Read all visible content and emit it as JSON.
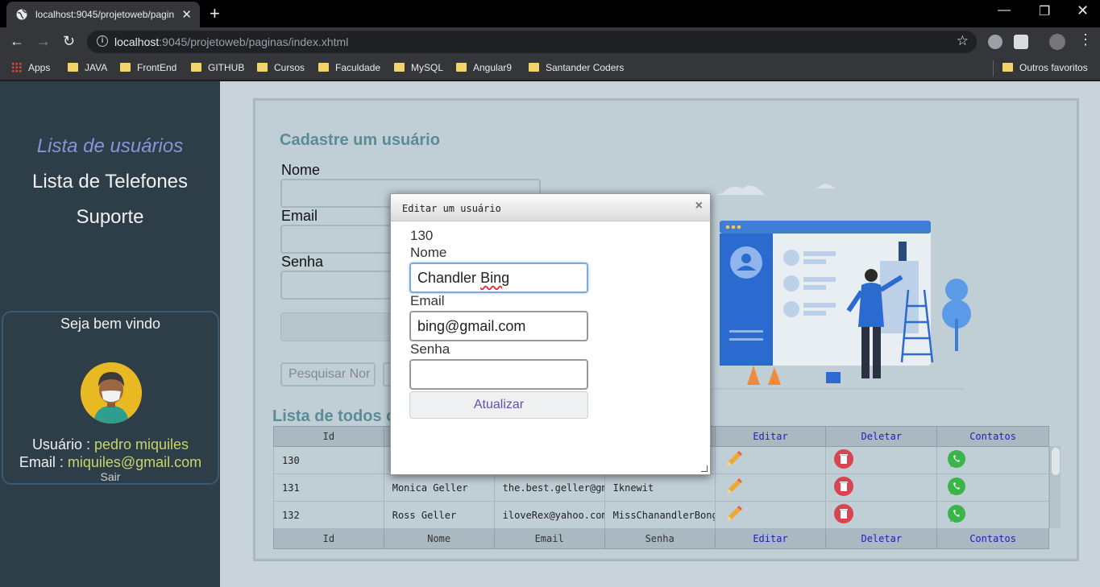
{
  "browser": {
    "tab_title": "localhost:9045/projetoweb/pagin",
    "url_host": "localhost",
    "url_rest": ":9045/projetoweb/paginas/index.xhtml",
    "bookmarks": [
      "Apps",
      "JAVA",
      "FrontEnd",
      "GITHUB",
      "Cursos",
      "Faculdade",
      "MySQL",
      "Angular9",
      "Santander Coders"
    ],
    "other_bookmarks": "Outros favoritos"
  },
  "sidebar": {
    "links": [
      "Lista de usuários",
      "Lista de Telefones",
      "Suporte"
    ],
    "welcome": "Seja bem vindo",
    "user_label": "Usuário :",
    "user_value": "pedro miquiles",
    "email_label": "Email :",
    "email_value": "miquiles@gmail.com",
    "logout": "Sair"
  },
  "form": {
    "title": "Cadastre um usuário",
    "name_label": "Nome",
    "email_label": "Email",
    "password_label": "Senha",
    "search_placeholder": "Pesquisar Nor"
  },
  "list": {
    "title": "Lista de todos o",
    "columns": [
      "Id",
      "Nome",
      "Email",
      "Senha",
      "Editar",
      "Deletar",
      "Contatos"
    ],
    "rows": [
      {
        "id": "130",
        "nome": "",
        "email": "",
        "senha": ""
      },
      {
        "id": "131",
        "nome": "Monica Geller",
        "email": "the.best.geller@gm",
        "senha": "Iknewit"
      },
      {
        "id": "132",
        "nome": "Ross Geller",
        "email": "iloveRex@yahoo.com",
        "senha": "MissChanandlerBong"
      }
    ]
  },
  "modal": {
    "title": "Editar um usuário",
    "close": "×",
    "id": "130",
    "name_label": "Nome",
    "name_first": "Chandler",
    "name_last": "Bing",
    "email_label": "Email",
    "email_value": "bing@gmail.com",
    "password_label": "Senha",
    "password_value": "",
    "submit": "Atualizar"
  },
  "colors": {
    "sidebar_bg": "#2e3e48",
    "active_link": "#8a93d8",
    "accent_title": "#5b8c96",
    "user_highlight": "#c7d46e",
    "button_text": "#6a4fa8"
  }
}
